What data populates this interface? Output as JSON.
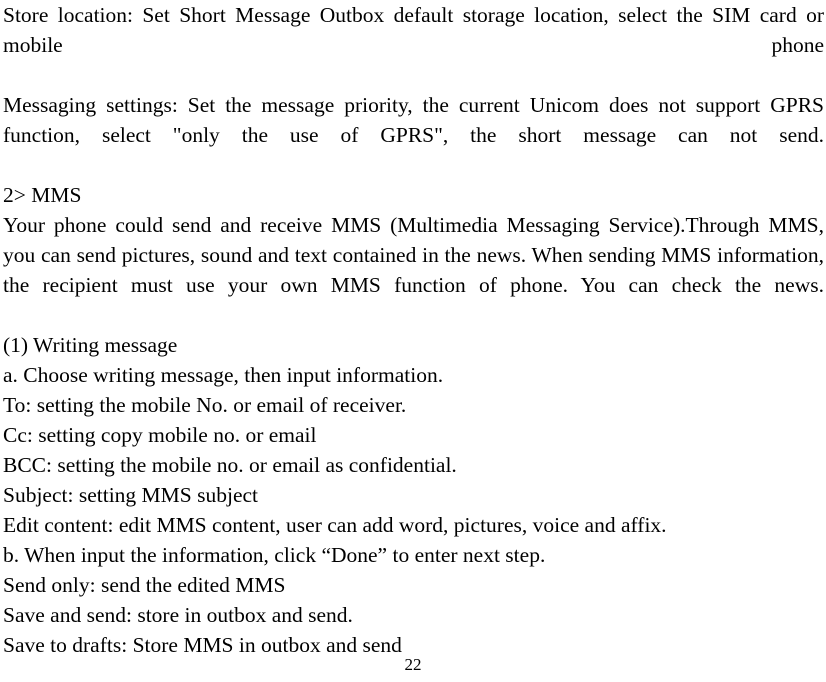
{
  "document": {
    "page_number": "22",
    "background_color": "#ffffff",
    "text_color": "#000000",
    "blocks": [
      {
        "id": "store-location",
        "type": "justified-paragraph",
        "text": "Store location: Set Short Message Outbox default storage location, select the SIM card or mobile phone"
      },
      {
        "id": "messaging-settings",
        "type": "justified-paragraph",
        "text": "Messaging settings: Set the message priority, the current Unicom does not support GPRS function, select \"only the use of GPRS\", the short message can not send."
      },
      {
        "id": "mms-heading",
        "type": "line",
        "text": "2> MMS"
      },
      {
        "id": "mms-intro",
        "type": "justified-paragraph",
        "text": "Your phone could send and receive MMS (Multimedia Messaging Service).Through MMS, you can send pictures, sound and text contained in the news. When sending MMS information, the recipient must use your own MMS function of phone. You can check the news."
      },
      {
        "id": "writing-message-heading",
        "type": "line",
        "text": "(1) Writing message"
      },
      {
        "id": "step-a",
        "type": "line",
        "text": "a. Choose writing message, then input information."
      },
      {
        "id": "field-to",
        "type": "line",
        "text": "To: setting the mobile No. or email of receiver."
      },
      {
        "id": "field-cc",
        "type": "line",
        "text": "Cc: setting copy mobile no. or email"
      },
      {
        "id": "field-bcc",
        "type": "line",
        "text": "BCC: setting the mobile no. or email as confidential."
      },
      {
        "id": "field-subject",
        "type": "line",
        "text": "Subject: setting MMS subject"
      },
      {
        "id": "field-edit-content",
        "type": "line",
        "text": "Edit content: edit MMS content, user can add word, pictures, voice and affix."
      },
      {
        "id": "step-b",
        "type": "line",
        "text": "b. When input the information, click “Done” to enter next step."
      },
      {
        "id": "option-send-only",
        "type": "line",
        "text": "Send only: send the edited MMS"
      },
      {
        "id": "option-save-and-send",
        "type": "line",
        "text": "Save and send: store in outbox and send."
      },
      {
        "id": "option-save-to-drafts",
        "type": "line",
        "text": "Save to drafts: Store MMS in outbox and send"
      }
    ]
  }
}
